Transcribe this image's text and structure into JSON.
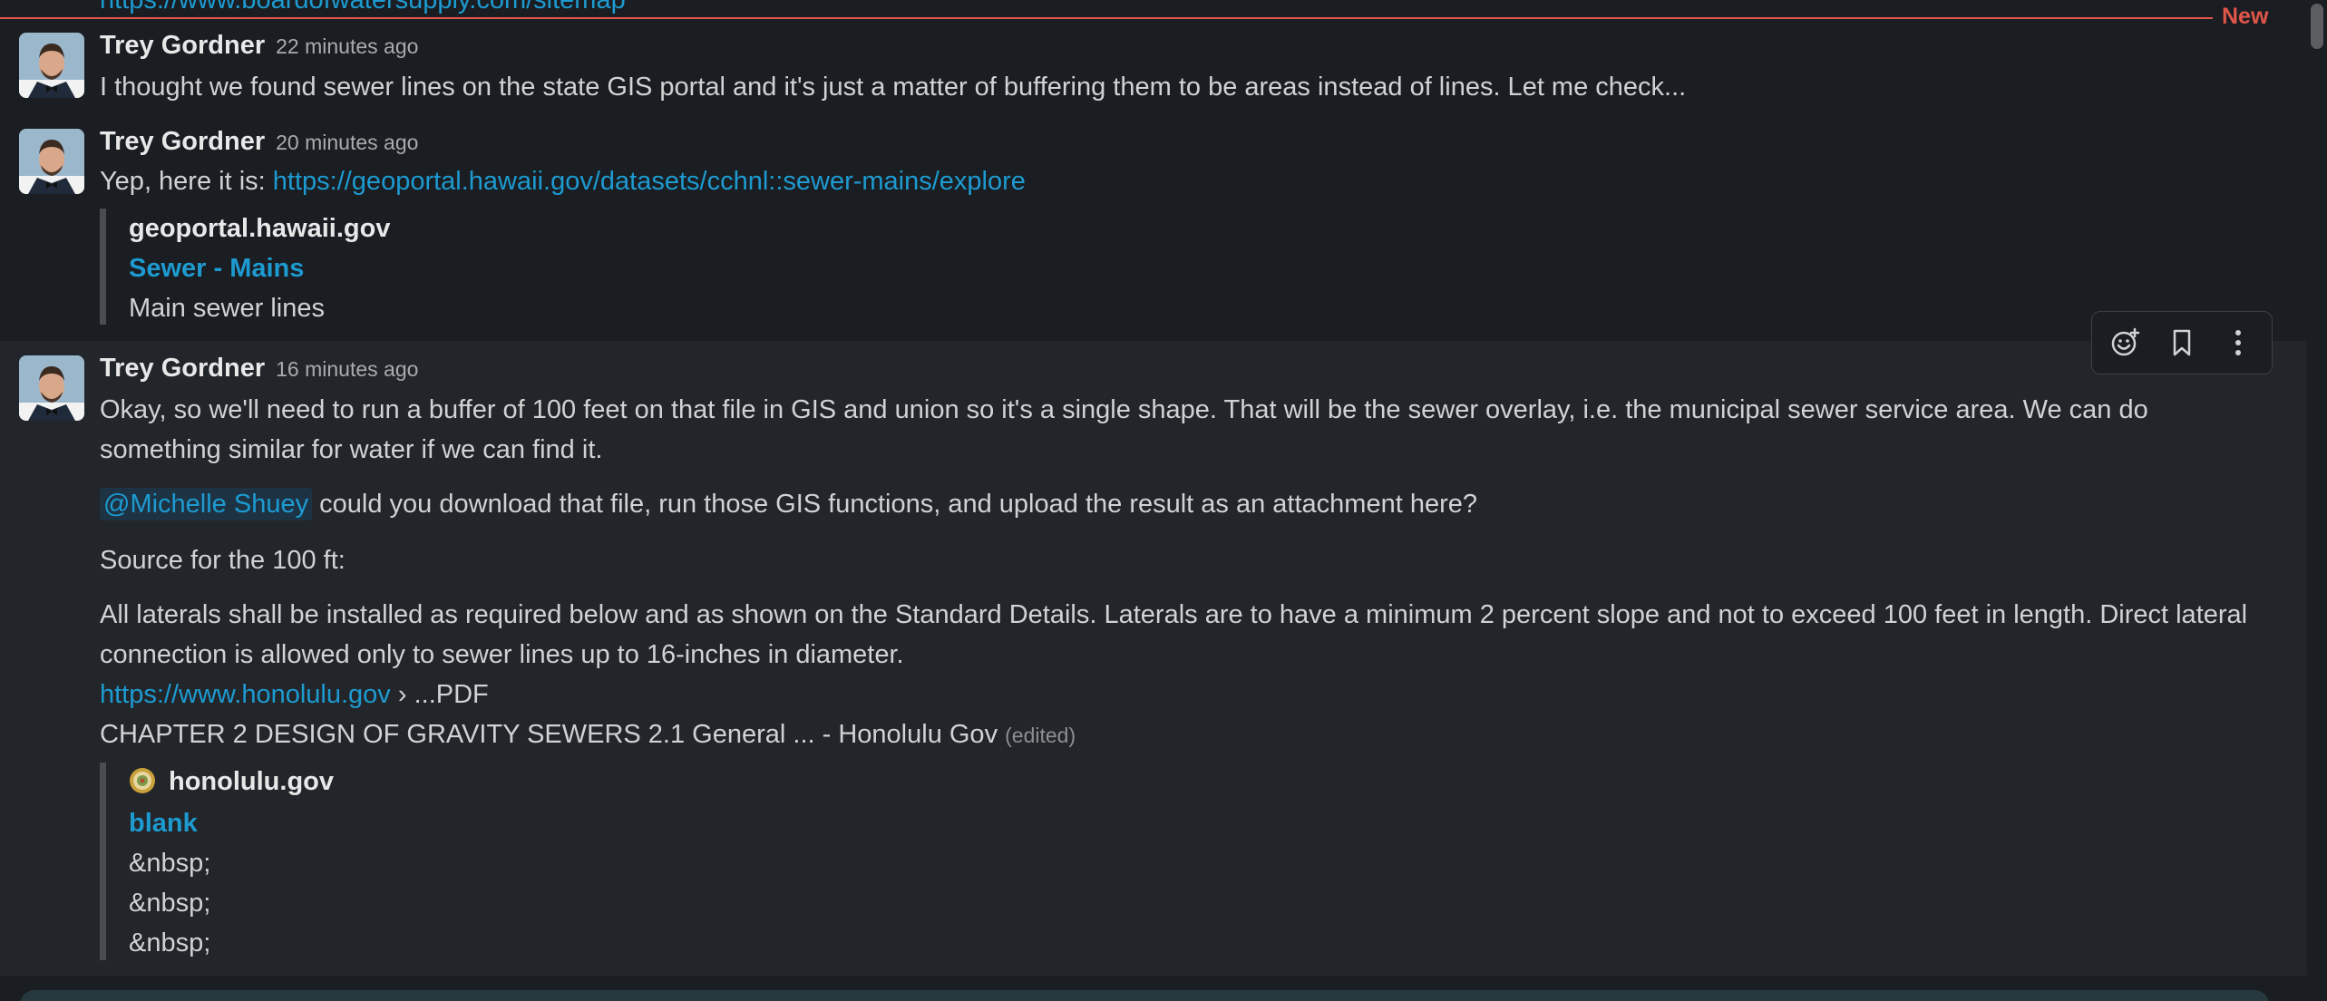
{
  "top": {
    "cut_link": "https://www.boardofwatersupply.com/sitemap",
    "new_label": "New"
  },
  "messages": [
    {
      "author": "Trey Gordner",
      "time": "22 minutes ago",
      "text": "I thought we found sewer lines on the state GIS portal and it's just a matter of buffering them to be areas instead of lines. Let me check..."
    },
    {
      "author": "Trey Gordner",
      "time": "20 minutes ago",
      "text_prefix": "Yep, here it is: ",
      "link": "https://geoportal.hawaii.gov/datasets/cchnl::sewer-mains/explore",
      "unfurl": {
        "site": "geoportal.hawaii.gov",
        "title": "Sewer - Mains",
        "description": "Main sewer lines"
      }
    },
    {
      "author": "Trey Gordner",
      "time": "16 minutes ago",
      "para1_line1": "Okay, so we'll need to run a buffer of 100 feet on that file in GIS and union so it's a single shape. That will be the sewer overlay, i.e. the municipal sewer service area. We can do",
      "para1_line2": "something similar for water if we can find it.",
      "mention": "@Michelle Shuey",
      "para2_rest": " could you download that file, run those GIS functions, and upload the result as an attachment here?",
      "para3": "Source for the 100 ft:",
      "para4_line1": "All laterals shall be installed as required below and as shown on the Standard Details. Laterals are to have a minimum 2 percent slope and not to exceed 100 feet in length. Direct lateral",
      "para4_line2": "connection is allowed only to sewer lines up to 16-inches in diameter.",
      "source_link": "https://www.honolulu.gov",
      "source_suffix": " › ...PDF",
      "source_title": "CHAPTER 2 DESIGN OF GRAVITY SEWERS 2.1 General ... - Honolulu Gov",
      "edited": "(edited)",
      "unfurl": {
        "site": "honolulu.gov",
        "title": "blank",
        "lines": [
          "&nbsp;",
          "&nbsp;",
          "&nbsp;"
        ]
      }
    }
  ],
  "toolbar": {
    "icons": [
      "add-reaction-icon",
      "bookmark-icon",
      "more-actions-icon"
    ]
  },
  "colors": {
    "background": "#1a1d21",
    "hover_background": "#222529",
    "link": "#1d9bd1",
    "new_divider": "#e0564a"
  }
}
